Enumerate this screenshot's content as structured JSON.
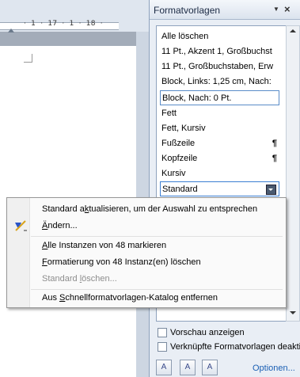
{
  "ruler": {
    "text": "·  1  ·  17  ·  1  ·  18  ·"
  },
  "pane": {
    "title": "Formatvorlagen",
    "styles": [
      {
        "label": "Alle löschen"
      },
      {
        "label": "11 Pt., Akzent 1, Großbuchst"
      },
      {
        "label": "11 Pt., Großbuchstaben, Erw"
      },
      {
        "label": "Block, Links:  1,25 cm, Nach:"
      },
      {
        "label": "Block, Nach:  0 Pt."
      },
      {
        "label": "Fett"
      },
      {
        "label": "Fett, Kursiv"
      },
      {
        "label": "Fußzeile",
        "mark": "¶"
      },
      {
        "label": "Kopfzeile",
        "mark": "¶"
      },
      {
        "label": "Kursiv"
      },
      {
        "label": "Standard"
      }
    ],
    "checkboxes": {
      "preview_label": "Vorschau anzeigen",
      "linked_label": "Verknüpfte Formatvorlagen deaktiv"
    },
    "options_label": "Optionen..."
  },
  "menu": {
    "update": {
      "before": "Standard a",
      "access": "k",
      "after": "tualisieren, um der Auswahl zu entsprechen"
    },
    "modify": {
      "before": "",
      "access": "Ä",
      "after": "ndern..."
    },
    "select_all": {
      "before": "",
      "access": "A",
      "after": "lle Instanzen von 48 markieren"
    },
    "clear_format": {
      "before": "",
      "access": "F",
      "after": "ormatierung von 48 Instanz(en) löschen"
    },
    "delete": {
      "before": "Standard ",
      "access": "l",
      "after": "öschen..."
    },
    "remove_gallery": {
      "before": "Aus ",
      "access": "S",
      "after": "chnellformatvorlagen-Katalog entfernen"
    }
  }
}
